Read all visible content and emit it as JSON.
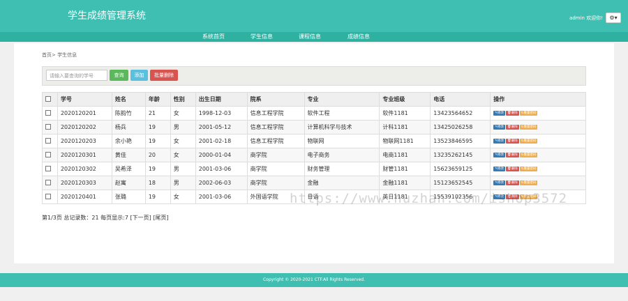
{
  "header": {
    "app_title": "学生成绩管理系统",
    "user_text": "admin 欢迎你!",
    "settings_icon": "gear-icon"
  },
  "nav": {
    "items": [
      "系统首页",
      "学生信息",
      "课程信息",
      "成绩信息"
    ]
  },
  "breadcrumb": "首页> 学生信息",
  "toolbar": {
    "search_placeholder": "请输入要查询的学号",
    "search_btn": "查询",
    "add_btn": "添加",
    "batch_delete_btn": "批量删除"
  },
  "table": {
    "headers": [
      "学号",
      "姓名",
      "年龄",
      "性别",
      "出生日期",
      "院系",
      "专业",
      "专业班级",
      "电话",
      "操作"
    ],
    "rows": [
      [
        "2020120201",
        "陈韵竹",
        "21",
        "女",
        "1998-12-03",
        "信息工程学院",
        "软件工程",
        "软件1181",
        "13423564652"
      ],
      [
        "2020120202",
        "杨兵",
        "19",
        "男",
        "2001-05-12",
        "信息工程学院",
        "计算机科学与技术",
        "计科1181",
        "13425026258"
      ],
      [
        "2020120203",
        "余小艳",
        "19",
        "女",
        "2001-02-18",
        "信息工程学院",
        "物联网",
        "物联网1181",
        "13523846595"
      ],
      [
        "2020120301",
        "黄佳",
        "20",
        "女",
        "2000-01-04",
        "商学院",
        "电子商务",
        "电商1181",
        "13235262145"
      ],
      [
        "2020120302",
        "吴希泽",
        "19",
        "男",
        "2001-03-06",
        "商学院",
        "财务管理",
        "财管1181",
        "15623659125"
      ],
      [
        "2020120303",
        "赵寓",
        "18",
        "男",
        "2002-06-03",
        "商学院",
        "金融",
        "金融1181",
        "15123652545"
      ],
      [
        "2020120401",
        "张璐",
        "19",
        "女",
        "2001-03-06",
        "外国语学院",
        "日语",
        "英日1181",
        "15539102356"
      ]
    ],
    "actions": {
      "edit": "修改",
      "delete": "删除",
      "reset": "重置密码"
    }
  },
  "pagination": "第1/3页 总记录数：21 每页显示:7 [下一页] [尾页]",
  "footer": "Copyright © 2020-2021 CTF.All Rights Reserved.",
  "watermark": "https://www.huzhan.com/ishop3572",
  "colors": {
    "primary": "#3ebfb1",
    "nav": "#2fb1a2",
    "success": "#5cb85c",
    "info": "#5bc0de",
    "danger": "#d9534f",
    "warning": "#f0ad4e"
  }
}
